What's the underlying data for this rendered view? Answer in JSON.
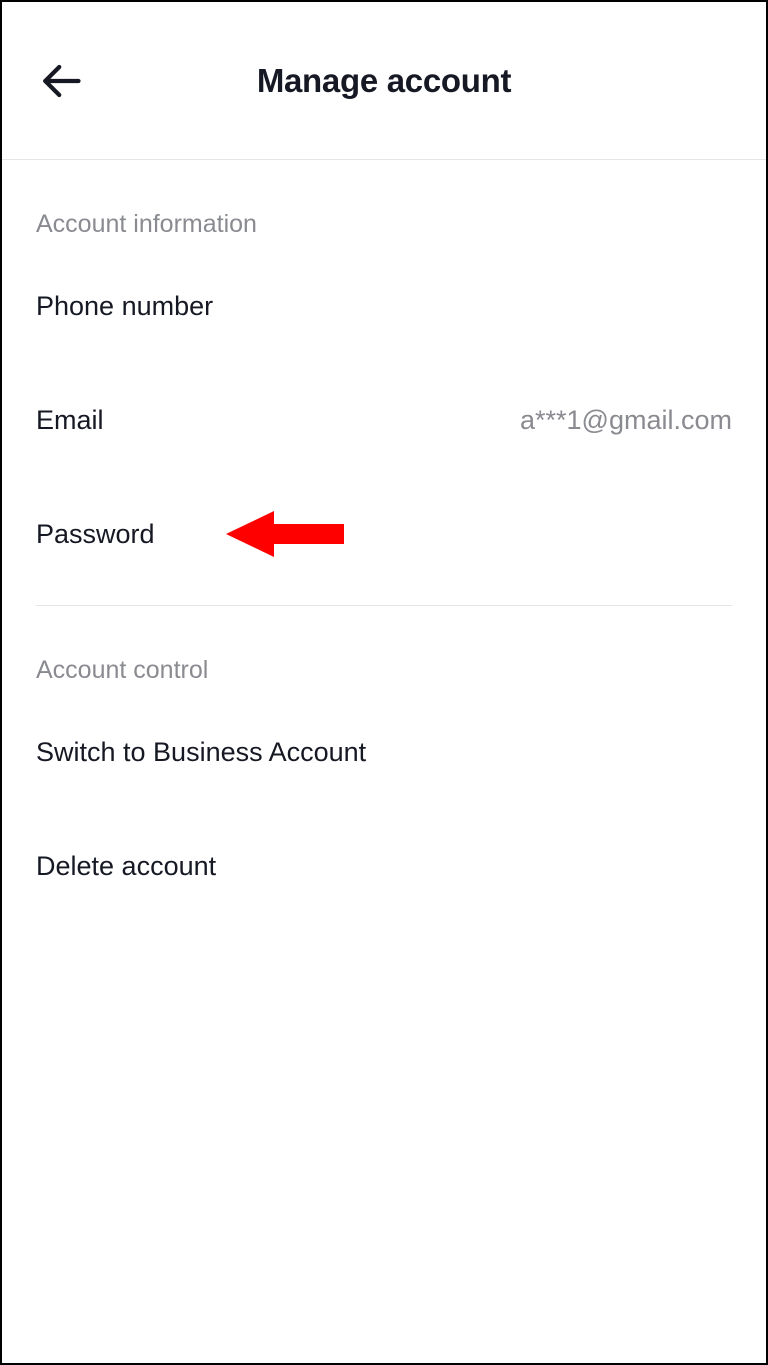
{
  "header": {
    "title": "Manage account"
  },
  "sections": {
    "account_info": {
      "header": "Account information",
      "phone": {
        "label": "Phone number",
        "value": ""
      },
      "email": {
        "label": "Email",
        "value": "a***1@gmail.com"
      },
      "password": {
        "label": "Password",
        "value": ""
      }
    },
    "account_control": {
      "header": "Account control",
      "switch_business": {
        "label": "Switch to Business Account"
      },
      "delete": {
        "label": "Delete account"
      }
    }
  }
}
